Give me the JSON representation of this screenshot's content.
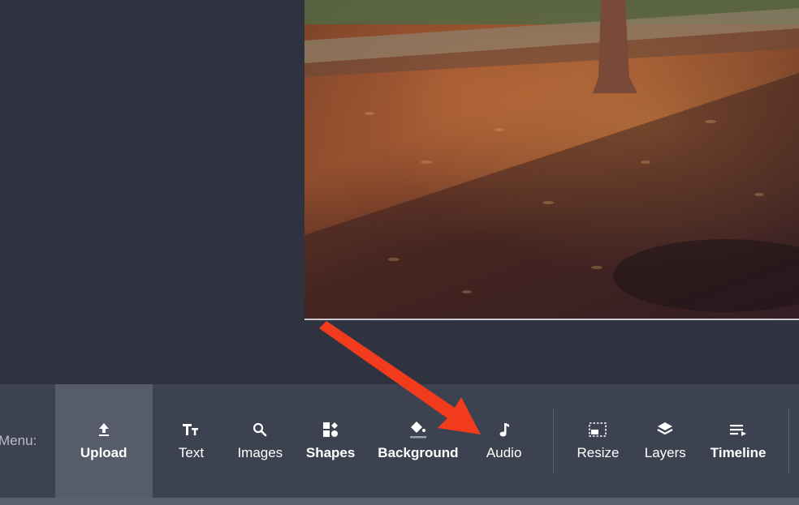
{
  "toolbar": {
    "menu_label": "Menu:",
    "items": [
      {
        "label": "Upload",
        "icon": "upload-icon",
        "active": true
      },
      {
        "label": "Text",
        "icon": "text-icon"
      },
      {
        "label": "Images",
        "icon": "search-icon"
      },
      {
        "label": "Shapes",
        "icon": "shapes-icon"
      },
      {
        "label": "Background",
        "icon": "paint-bucket-icon"
      },
      {
        "label": "Audio",
        "icon": "music-note-icon"
      },
      {
        "label": "Resize",
        "icon": "resize-icon"
      },
      {
        "label": "Layers",
        "icon": "layers-icon"
      },
      {
        "label": "Timeline",
        "icon": "timeline-icon"
      }
    ]
  },
  "colors": {
    "workspace": "#2f3340",
    "toolbar": "#3d4250",
    "active_tool": "#575c6a",
    "annotation_arrow": "#f23a1d"
  }
}
